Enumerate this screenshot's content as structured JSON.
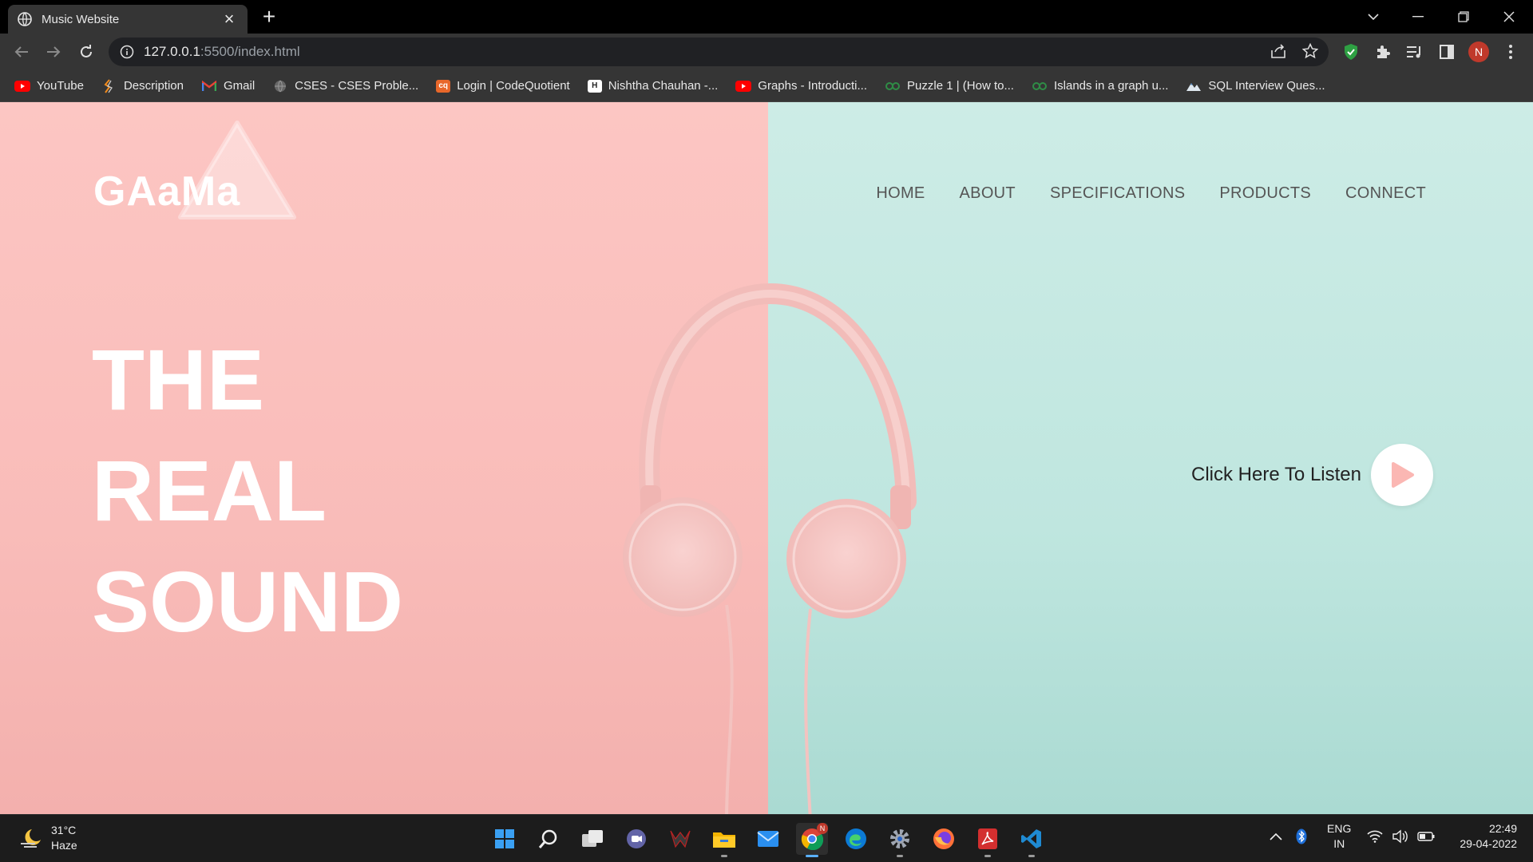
{
  "browser": {
    "tab_title": "Music Website",
    "url_host": "127.0.0.1",
    "url_path": ":5500/index.html",
    "profile_initial": "N"
  },
  "bookmarks": [
    {
      "label": "YouTube",
      "icon": "youtube-icon"
    },
    {
      "label": "Description",
      "icon": "description-icon"
    },
    {
      "label": "Gmail",
      "icon": "gmail-icon"
    },
    {
      "label": "CSES - CSES Proble...",
      "icon": "globe-icon"
    },
    {
      "label": "Login | CodeQuotient",
      "icon": "codequotient-icon"
    },
    {
      "label": "Nishtha Chauhan -...",
      "icon": "hackerearth-icon"
    },
    {
      "label": "Graphs - Introducti...",
      "icon": "youtube-icon"
    },
    {
      "label": "Puzzle 1 | (How to...",
      "icon": "geeksforgeeks-icon"
    },
    {
      "label": "Islands in a graph u...",
      "icon": "geeksforgeeks-icon"
    },
    {
      "label": "SQL Interview Ques...",
      "icon": "mountain-icon"
    }
  ],
  "site": {
    "logo": "GAaMa",
    "nav": [
      "HOME",
      "ABOUT",
      "SPECIFICATIONS",
      "PRODUCTS",
      "CONNECT"
    ],
    "hero": [
      "THE",
      "REAL",
      "SOUND"
    ],
    "listen_label": "Click Here To Listen"
  },
  "taskbar": {
    "temperature": "31°C",
    "weather": "Haze",
    "lang_top": "ENG",
    "lang_bottom": "IN",
    "time": "22:49",
    "date": "29-04-2022",
    "chrome_badge": "N"
  },
  "colors": {
    "left_panel": "#fcc6c3",
    "right_panel": "#c6eae4",
    "play_triangle": "#fbb7b3"
  }
}
